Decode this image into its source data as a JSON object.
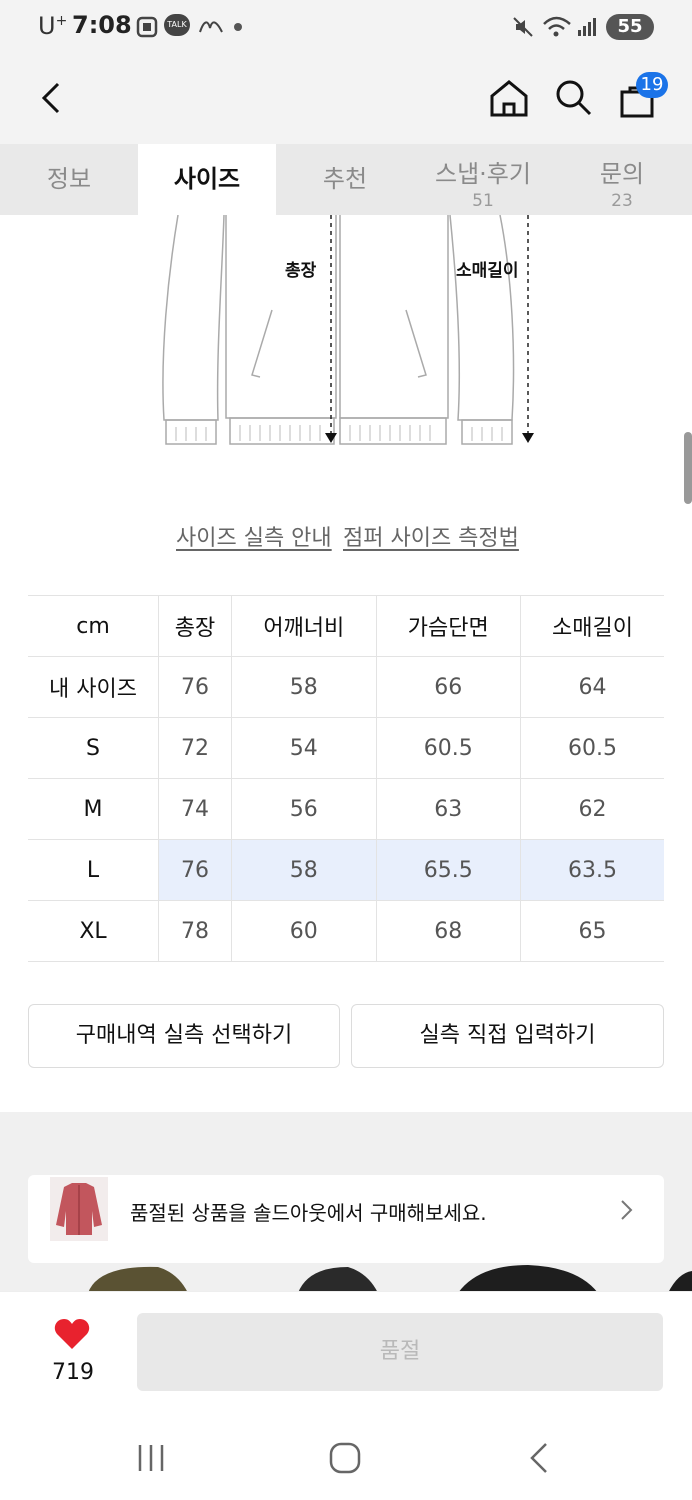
{
  "status_bar": {
    "carrier": "U",
    "carrier_sup": "+",
    "time": "7:08",
    "talk_label": "TALK",
    "battery": "55"
  },
  "header": {
    "cart_count": "19"
  },
  "tabs": [
    {
      "label": "정보",
      "sub": ""
    },
    {
      "label": "사이즈",
      "sub": ""
    },
    {
      "label": "추천",
      "sub": ""
    },
    {
      "label": "스냅·후기",
      "sub": "51"
    },
    {
      "label": "문의",
      "sub": "23"
    }
  ],
  "diagram": {
    "length_label": "총장",
    "sleeve_label": "소매길이"
  },
  "links": {
    "size_guide": "사이즈 실측 안내",
    "measure_guide": "점퍼 사이즈 측정법"
  },
  "size_table": {
    "headers": [
      "cm",
      "총장",
      "어깨너비",
      "가슴단면",
      "소매길이"
    ],
    "rows": [
      [
        "내 사이즈",
        "76",
        "58",
        "66",
        "64"
      ],
      [
        "S",
        "72",
        "54",
        "60.5",
        "60.5"
      ],
      [
        "M",
        "74",
        "56",
        "63",
        "62"
      ],
      [
        "L",
        "76",
        "58",
        "65.5",
        "63.5"
      ],
      [
        "XL",
        "78",
        "60",
        "68",
        "65"
      ]
    ],
    "highlight_row": "L"
  },
  "buttons": {
    "purchase_history": "구매내역 실측 선택하기",
    "direct_input": "실측 직접 입력하기"
  },
  "sold_out_banner": {
    "text": "품절된 상품을 솔드아웃에서 구매해보세요."
  },
  "bottom": {
    "likes": "719",
    "sold_out_label": "품절"
  },
  "colors": {
    "accent_blue": "#1a73e8",
    "heart_red": "#e8222e",
    "highlight": "#e8effc"
  }
}
